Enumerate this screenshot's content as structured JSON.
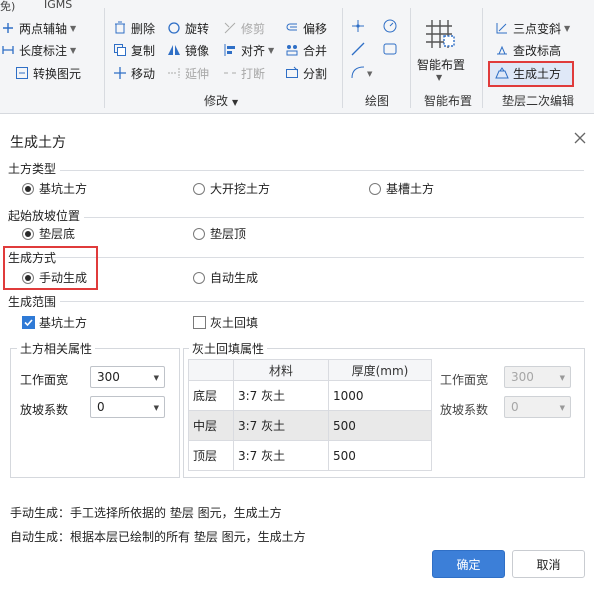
{
  "ribbon": {
    "top_left": "免)",
    "app_name": "IGMS",
    "buttons": {
      "two_point_axis": "两点辅轴",
      "length_dim": "长度标注",
      "convert_element": "转换图元",
      "delete": "删除",
      "copy": "复制",
      "move": "移动",
      "rotate": "旋转",
      "mirror": "镜像",
      "extend": "延伸",
      "trim": "修剪",
      "align": "对齐",
      "break": "打断",
      "offset": "偏移",
      "merge": "合并",
      "split": "分割",
      "smart_layout": "智能布置",
      "three_point_arc": "三点变斜",
      "check_elevation": "查改标高",
      "generate_earthwork": "生成土方"
    },
    "groups": {
      "modify": "修改",
      "draw": "绘图",
      "smart_layout": "智能布置",
      "cushion_edit": "垫层二次编辑"
    }
  },
  "dialog": {
    "title": "生成土方",
    "earthwork_type": {
      "title": "土方类型",
      "options": [
        "基坑土方",
        "大开挖土方",
        "基槽土方"
      ],
      "selected": 0
    },
    "slope_start": {
      "title": "起始放坡位置",
      "options": [
        "垫层底",
        "垫层顶"
      ],
      "selected": 0
    },
    "gen_method": {
      "title": "生成方式",
      "options": [
        "手动生成",
        "自动生成"
      ],
      "selected": 0
    },
    "gen_range": {
      "title": "生成范围",
      "pit": "基坑土方",
      "pit_checked": true,
      "lime": "灰土回填",
      "lime_checked": false
    },
    "earth_props": {
      "title": "土方相关属性",
      "work_width_label": "工作面宽",
      "work_width": "300",
      "slope_label": "放坡系数",
      "slope": "0"
    },
    "lime_props": {
      "title": "灰土回填属性",
      "columns": [
        "",
        "材料",
        "厚度(mm)"
      ],
      "rows": [
        {
          "layer": "底层",
          "material": "3:7 灰土",
          "thickness": "1000"
        },
        {
          "layer": "中层",
          "material": "3:7 灰土",
          "thickness": "500"
        },
        {
          "layer": "顶层",
          "material": "3:7 灰土",
          "thickness": "500"
        }
      ],
      "work_width_label": "工作面宽",
      "work_width": "300",
      "slope_label": "放坡系数",
      "slope": "0"
    },
    "notes": {
      "manual": "手动生成：手工选择所依据的 垫层 图元，生成土方",
      "auto": "自动生成：根据本层已绘制的所有 垫层 图元，生成土方"
    },
    "ok": "确定",
    "cancel": "取消"
  },
  "colors": {
    "accent": "#3c7fd8",
    "highlight": "#e03b3b",
    "selected_row": "#e9e9e9"
  }
}
